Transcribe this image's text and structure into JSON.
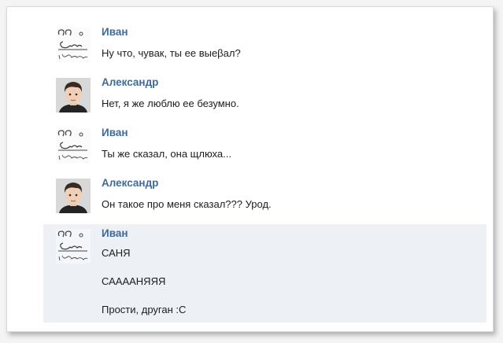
{
  "colors": {
    "name": "#3f6a96",
    "text": "#1c1c1c",
    "highlight": "#edf0f5",
    "background": "#ffffff"
  },
  "messages": [
    {
      "author": "Иван",
      "avatar_icon": "sketch-avatar-icon",
      "lines": [
        "Ну что, чувак, ты ее выеβал?"
      ]
    },
    {
      "author": "Александр",
      "avatar_icon": "cartoon-man-avatar-icon",
      "lines": [
        "Нет, я же люблю ее безумно."
      ]
    },
    {
      "author": "Иван",
      "avatar_icon": "sketch-avatar-icon",
      "lines": [
        "Ты же сказал, она щлюха..."
      ]
    },
    {
      "author": "Александр",
      "avatar_icon": "cartoon-man-avatar-icon",
      "lines": [
        "Он такое про меня сказал??? Урод."
      ]
    },
    {
      "author": "Иван",
      "avatar_icon": "sketch-avatar-icon",
      "highlighted": true,
      "lines": [
        "САНЯ",
        "САААAНЯЯЯ",
        "Прости, друган :С"
      ]
    }
  ]
}
